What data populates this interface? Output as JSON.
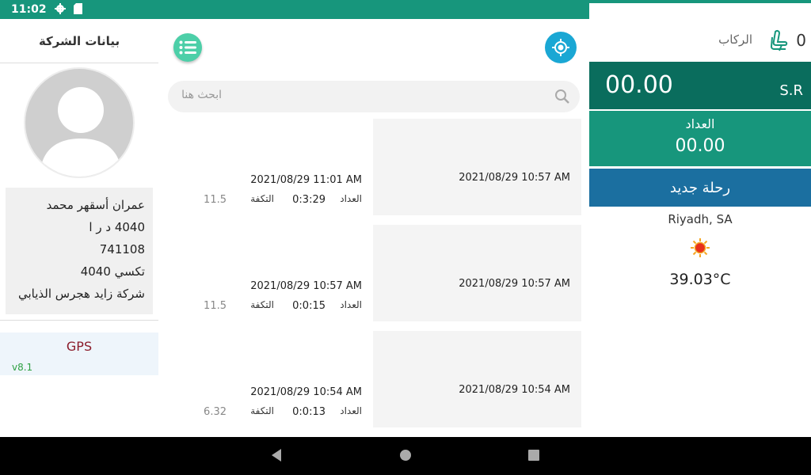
{
  "status_bar": {
    "time": "11:02",
    "icons": [
      "settings-icon",
      "sd-card-icon",
      "location-icon",
      "wifi-icon",
      "signal-icon",
      "battery-icon"
    ]
  },
  "company_panel": {
    "title": "بيانات الشركة",
    "driver_name": "عمران أسقهر محمد",
    "plate": "4040 د ر ا",
    "id_number": "741108",
    "vehicle": "تكسي 4040",
    "company": "شركة زايد هجرس الذيابي",
    "gps_label": "GPS",
    "version": "v8.1"
  },
  "search": {
    "placeholder": "ابحث هنا"
  },
  "trips": [
    {
      "card_date": "2021/08/29 10:57 AM",
      "end_date": "2021/08/29  11:01 AM",
      "meter_label": "العداد",
      "meter_value": "0:3:29",
      "cost_label": "التكفة",
      "cost_value": "11.5"
    },
    {
      "card_date": "2021/08/29 10:57 AM",
      "end_date": "2021/08/29  10:57 AM",
      "meter_label": "العداد",
      "meter_value": "0:0:15",
      "cost_label": "التكفة",
      "cost_value": "11.5"
    },
    {
      "card_date": "2021/08/29 10:54 AM",
      "end_date": "2021/08/29  10:54 AM",
      "meter_label": "العداد",
      "meter_value": "0:0:13",
      "cost_label": "التكفة",
      "cost_value": "6.32"
    }
  ],
  "right_panel": {
    "riders_count": "0",
    "riders_label": "الركاب",
    "fare_amount": "00.00",
    "currency": "S.R",
    "meter_label": "العداد",
    "meter_value": "00.00",
    "new_trip_label": "رحلة جديد",
    "weather_city": "Riyadh, SA",
    "weather_icon": "sun-icon",
    "weather_temp": "39.03°C"
  },
  "colors": {
    "status_bar": "#17967c",
    "fare_bg": "#0a6d5d",
    "meter_bg": "#17967c",
    "new_trip_bg": "#1b6fa0",
    "gps_button": "#1aa7d4",
    "menu_button": "#4ccfa8"
  }
}
